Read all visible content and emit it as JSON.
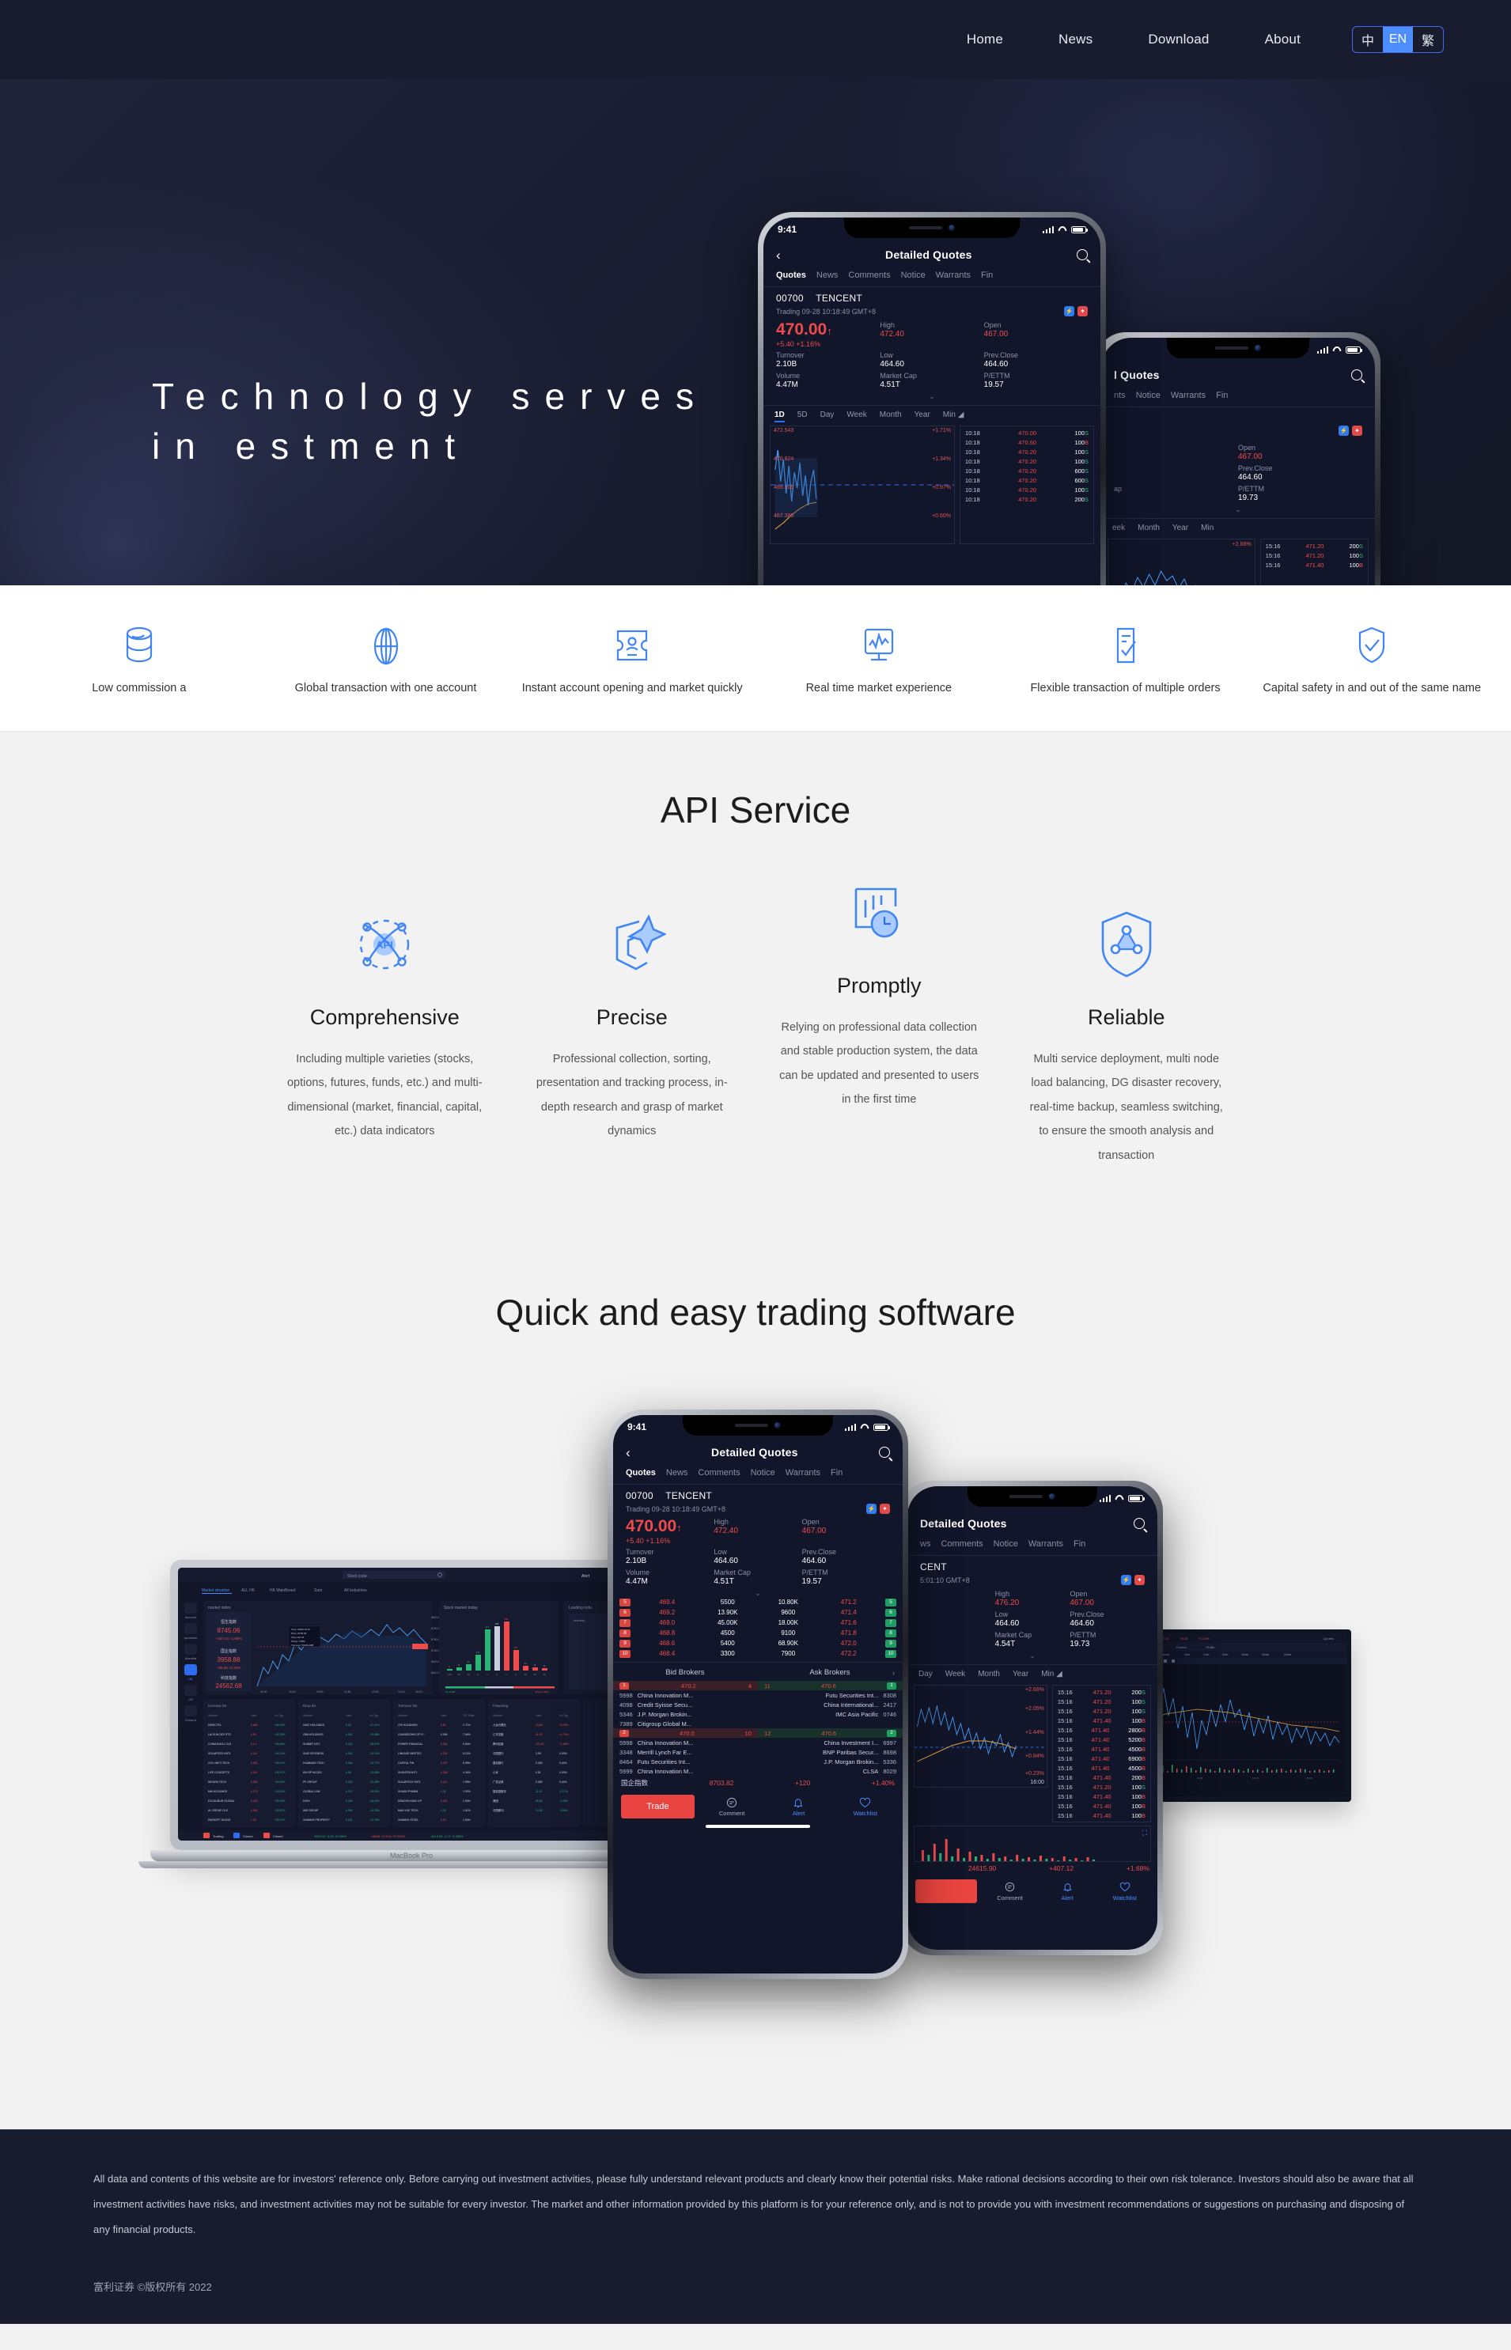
{
  "header": {
    "nav": [
      {
        "label": "Home"
      },
      {
        "label": "News"
      },
      {
        "label": "Download"
      },
      {
        "label": "About"
      }
    ],
    "lang_switch": {
      "options": [
        {
          "label": "中",
          "active": false
        },
        {
          "label": "EN",
          "active": true
        },
        {
          "label": "繁",
          "active": false
        }
      ],
      "accent": "#4c8dff"
    }
  },
  "hero": {
    "title": "Technology serves in estment",
    "background": "#1a1e32"
  },
  "features": [
    {
      "icon": "database-icon",
      "label": "Low commission a"
    },
    {
      "icon": "globe-icon",
      "label": "Global transaction with one account"
    },
    {
      "icon": "id-card-icon",
      "label": "Instant account opening and market quickly"
    },
    {
      "icon": "monitor-chart-icon",
      "label": "Real time market experience"
    },
    {
      "icon": "checklist-document-icon",
      "label": "Flexible transaction of multiple orders"
    },
    {
      "icon": "shield-check-icon",
      "label": "Capital safety in and out of the same name"
    }
  ],
  "api_section": {
    "title": "API Service",
    "cards": [
      {
        "icon": "api-orbit-icon",
        "title": "Comprehensive",
        "body": "Including multiple varieties (stocks, options, futures, funds, etc.) and multi-dimensional (market, financial, capital, etc.) data indicators"
      },
      {
        "icon": "precision-pen-icon",
        "title": "Precise",
        "body": "Professional collection, sorting, presentation and tracking process, in-depth research and grasp of market dynamics"
      },
      {
        "icon": "clock-chart-icon",
        "title": "Promptly",
        "body": "Relying on professional data collection and stable production system, the data can be updated and presented to users in the first time"
      },
      {
        "icon": "shield-network-icon",
        "title": "Reliable",
        "body": "Multi service deployment, multi node load balancing, DG disaster recovery, real-time backup, seamless switching, to ensure the smooth analysis and transaction"
      }
    ]
  },
  "software_section": {
    "title": "Quick and easy trading software",
    "laptop_label": "MacBook Pro"
  },
  "phone_app": {
    "status": {
      "time": "9:41"
    },
    "navbar": {
      "title": "Detailed Quotes",
      "back_icon": "chevron-left-icon",
      "search_icon": "search-icon"
    },
    "tabs": [
      "Quotes",
      "News",
      "Comments",
      "Notice",
      "Warrants",
      "Fin"
    ],
    "active_tab": "Quotes",
    "stock": {
      "code": "00700",
      "name": "TENCENT",
      "trading_line": "Trading 09-28 10:18:49 GMT+8",
      "last": "470.00",
      "change": "+5.40",
      "change_pct": "+1.16%",
      "stats": [
        {
          "label": "Turnover",
          "value": "2.10B",
          "red": false
        },
        {
          "label": "High",
          "value": "472.40",
          "red": true
        },
        {
          "label": "Open",
          "value": "467.00",
          "red": true
        },
        {
          "label": "Volume",
          "value": "4.47M",
          "red": false
        },
        {
          "label": "Low",
          "value": "464.60",
          "red": false
        },
        {
          "label": "Prev.Close",
          "value": "464.60",
          "red": false
        },
        {
          "label": "",
          "value": "",
          "red": false
        },
        {
          "label": "Market Cap",
          "value": "4.51T",
          "red": false
        },
        {
          "label": "P/ETTM",
          "value": "19.57",
          "red": false
        }
      ]
    },
    "range_tabs": [
      "1D",
      "5D",
      "Day",
      "Week",
      "Month",
      "Year",
      "Min"
    ],
    "active_range": "1D",
    "chart_labels": [
      {
        "price": "472.543",
        "pct": "+1.71%"
      },
      {
        "price": "470.824",
        "pct": "+1.34%"
      },
      {
        "price": "469.105",
        "pct": "+0.97%"
      },
      {
        "price": "467.386",
        "pct": "+0.60%"
      }
    ],
    "ticks": [
      {
        "time": "10:18",
        "price": "470.00",
        "vol": "100",
        "side": "S"
      },
      {
        "time": "10:18",
        "price": "470.60",
        "vol": "100",
        "side": "B"
      },
      {
        "time": "10:18",
        "price": "470.20",
        "vol": "100",
        "side": "S"
      },
      {
        "time": "10:18",
        "price": "470.20",
        "vol": "100",
        "side": "S"
      },
      {
        "time": "10:18",
        "price": "470.20",
        "vol": "600",
        "side": "S"
      },
      {
        "time": "10:18",
        "price": "470.20",
        "vol": "600",
        "side": "S"
      },
      {
        "time": "10:18",
        "price": "470.20",
        "vol": "100",
        "side": "S"
      },
      {
        "time": "10:18",
        "price": "470.20",
        "vol": "200",
        "side": "S"
      }
    ],
    "orderbook": [
      {
        "n": "5",
        "bid": "469.4",
        "bid_qty": "5500",
        "ask_qty": "10.80K",
        "ask": "471.2"
      },
      {
        "n": "6",
        "bid": "469.2",
        "bid_qty": "13.90K",
        "ask_qty": "9600",
        "ask": "471.4"
      },
      {
        "n": "7",
        "bid": "469.0",
        "bid_qty": "45.00K",
        "ask_qty": "18.00K",
        "ask": "471.6"
      },
      {
        "n": "8",
        "bid": "468.8",
        "bid_qty": "4500",
        "ask_qty": "9100",
        "ask": "471.8"
      },
      {
        "n": "9",
        "bid": "468.6",
        "bid_qty": "5400",
        "ask_qty": "68.90K",
        "ask": "472.0"
      },
      {
        "n": "10",
        "bid": "468.4",
        "bid_qty": "3300",
        "ask_qty": "7900",
        "ask": "472.2"
      }
    ],
    "brokers": {
      "bid_header": "Bid Brokers",
      "ask_header": "Ask Brokers",
      "levels": [
        {
          "bid_idx": "1",
          "bid_price": "470.2",
          "bid_count": "4",
          "ask_count": "11",
          "ask_price": "470.6",
          "ask_idx": "1",
          "bid_rows": [
            {
              "num": "5998",
              "name": "China Innovation M..."
            },
            {
              "num": "4098",
              "name": "Credit Syisse Secu..."
            },
            {
              "num": "5346",
              "name": "J.P. Morgan Brokin..."
            },
            {
              "num": "7389",
              "name": "Citigroup Global M..."
            }
          ],
          "ask_rows": [
            {
              "name": "Futu Securities Int...",
              "num": "8308"
            },
            {
              "name": "China International...",
              "num": "2417"
            },
            {
              "name": "IMC Asia Pacific",
              "num": "0746"
            }
          ]
        },
        {
          "bid_idx": "2",
          "bid_price": "470.0",
          "bid_count": "10",
          "ask_count": "12",
          "ask_price": "470.6",
          "ask_idx": "2",
          "bid_rows": [
            {
              "num": "5998",
              "name": "China Innovation M..."
            },
            {
              "num": "3348",
              "name": "Merrill Lynch Far E..."
            },
            {
              "num": "8464",
              "name": "Futu Securities Int..."
            },
            {
              "num": "5999",
              "name": "China Innovation M..."
            }
          ],
          "ask_rows": [
            {
              "name": "China Investment I...",
              "num": "6997"
            },
            {
              "name": "BNP Paribas Secur...",
              "num": "8698"
            },
            {
              "name": "J.P. Morgan Brokin...",
              "num": "5336"
            },
            {
              "name": "CLSA",
              "num": "8029"
            }
          ]
        }
      ]
    },
    "index_row": {
      "name": "国企指数",
      "value": "8703.82",
      "change": "+120",
      "pct": "+1.40%"
    },
    "bottom_bar": {
      "trade_label": "Trade",
      "items": [
        {
          "icon": "comment-icon",
          "label": "Comment",
          "active": false
        },
        {
          "icon": "bell-icon",
          "label": "Alert",
          "active": true
        },
        {
          "icon": "heart-icon",
          "label": "Watchlist",
          "active": true
        }
      ]
    }
  },
  "phone_side": {
    "navbar_title_partial": "l Quotes",
    "tabs_partial": [
      "nts",
      "Notice",
      "Warrants",
      "Fin"
    ],
    "stats": [
      {
        "label": "Open",
        "value": "467.00",
        "red": true
      },
      {
        "label": "Prev.Close",
        "value": "464.60",
        "red": false
      },
      {
        "label": "P/ETTM",
        "value": "19.73",
        "red": false
      }
    ],
    "range_tabs_partial": [
      "eek",
      "Month",
      "Year",
      "Min"
    ],
    "chart_pct": "+2.66%"
  },
  "phone_right": {
    "navbar_title": "Detailed Quotes",
    "tabs_partial": [
      "ws",
      "Comments",
      "Notice",
      "Warrants",
      "Fin"
    ],
    "name_partial": "CENT",
    "trading_partial": "5:01:10 GMT+8",
    "stats": [
      {
        "label": "High",
        "value": "476.20",
        "red": true
      },
      {
        "label": "Open",
        "value": "467.00",
        "red": true
      },
      {
        "label": "Low",
        "value": "464.60",
        "red": false
      },
      {
        "label": "Prev.Close",
        "value": "464.60",
        "red": false
      },
      {
        "label": "Market Cap",
        "value": "4.54T",
        "red": false
      },
      {
        "label": "P/ETTM",
        "value": "19.73",
        "red": false
      }
    ],
    "range_tabs_partial": [
      "Day",
      "Week",
      "Month",
      "Year",
      "Min"
    ],
    "chart_labels": [
      "+2.66%",
      "+2.05%",
      "+1.44%",
      "+0.84%",
      "+0.23%"
    ],
    "chart_time": "16:00",
    "ticks": [
      {
        "time": "15:16",
        "price": "471.20",
        "vol": "200",
        "side": "S"
      },
      {
        "time": "15:16",
        "price": "471.20",
        "vol": "100",
        "side": "S"
      },
      {
        "time": "15:16",
        "price": "471.20",
        "vol": "100",
        "side": "S"
      },
      {
        "time": "15:16",
        "price": "471.40",
        "vol": "100",
        "side": "B"
      },
      {
        "time": "15:16",
        "price": "471.40",
        "vol": "2800",
        "side": "B"
      },
      {
        "time": "15:16",
        "price": "471.40",
        "vol": "5200",
        "side": "B"
      },
      {
        "time": "15:16",
        "price": "471.40",
        "vol": "4500",
        "side": "B"
      },
      {
        "time": "15:16",
        "price": "471.40",
        "vol": "6900",
        "side": "B"
      },
      {
        "time": "15:16",
        "price": "471.40",
        "vol": "4500",
        "side": "B"
      },
      {
        "time": "15:16",
        "price": "471.40",
        "vol": "200",
        "side": "B"
      },
      {
        "time": "15:16",
        "price": "471.20",
        "vol": "100",
        "side": "S"
      },
      {
        "time": "15:16",
        "price": "471.40",
        "vol": "100",
        "side": "B"
      },
      {
        "time": "15:16",
        "price": "471.40",
        "vol": "100",
        "side": "B"
      },
      {
        "time": "15:16",
        "price": "471.40",
        "vol": "100",
        "side": "B"
      }
    ],
    "index_row": {
      "value": "24615.90",
      "change": "+407.12",
      "pct": "+1.68%"
    },
    "bottom_bar": {
      "items": [
        {
          "label": "Comment"
        },
        {
          "label": "Alert"
        },
        {
          "label": "Watchlist"
        }
      ]
    }
  },
  "desktop_app": {
    "search_placeholder": "Stock code.",
    "nav_tabs": [
      "Market situation",
      "ALL HK",
      "HK MainBoard",
      "Sam",
      "All Industries"
    ],
    "sidebar": [
      "Account",
      "quotation",
      "Alandita",
      "HK",
      "US",
      "China-A"
    ],
    "panels": {
      "market_index": "market index",
      "stock_market_today": "Stock market today",
      "leading_industry": "Leading Indu",
      "increase_list": "Increase list",
      "drop_list": "Drop list",
      "turnover_list": "Turnover list",
      "financing": "Financing"
    },
    "index_cards": [
      {
        "name": "恒生指数",
        "value": "8745.06",
        "change": "+167.24 +1.68%"
      },
      {
        "name": "国企指数",
        "value": "3958.88",
        "change": "+86.68 +2.24%"
      },
      {
        "name": "科技指数",
        "value": "24562.68",
        "change": "+313.90 +1.48%"
      }
    ],
    "columns": [
      "Symbol",
      "Last",
      "% Chg"
    ],
    "bar_chart": {
      "values": [
        0,
        11,
        42,
        141,
        477,
        756,
        866,
        347,
        44,
        16,
        12
      ],
      "labels": [
        "+20",
        "15-20",
        "10-15",
        "5-10",
        "0-5",
        "0",
        "0-5",
        "5-10",
        "10-15",
        "15-20",
        "+20"
      ]
    },
    "status": {
      "trading": "Trading",
      "closed": "Closed"
    }
  },
  "footer": {
    "disclaimer": "All data and contents of this website are for investors' reference only. Before carrying out investment activities, please fully understand relevant products and clearly know their potential risks. Make rational decisions according to their own risk tolerance. Investors should also be aware that all investment activities have risks, and investment activities may not be suitable for every investor. The market and other information provided by this platform is for your reference only, and is not to provide you with investment recommendations or suggestions on purchasing and disposing of any financial products.",
    "copyright": "富利证券 ©版权所有 2022"
  }
}
